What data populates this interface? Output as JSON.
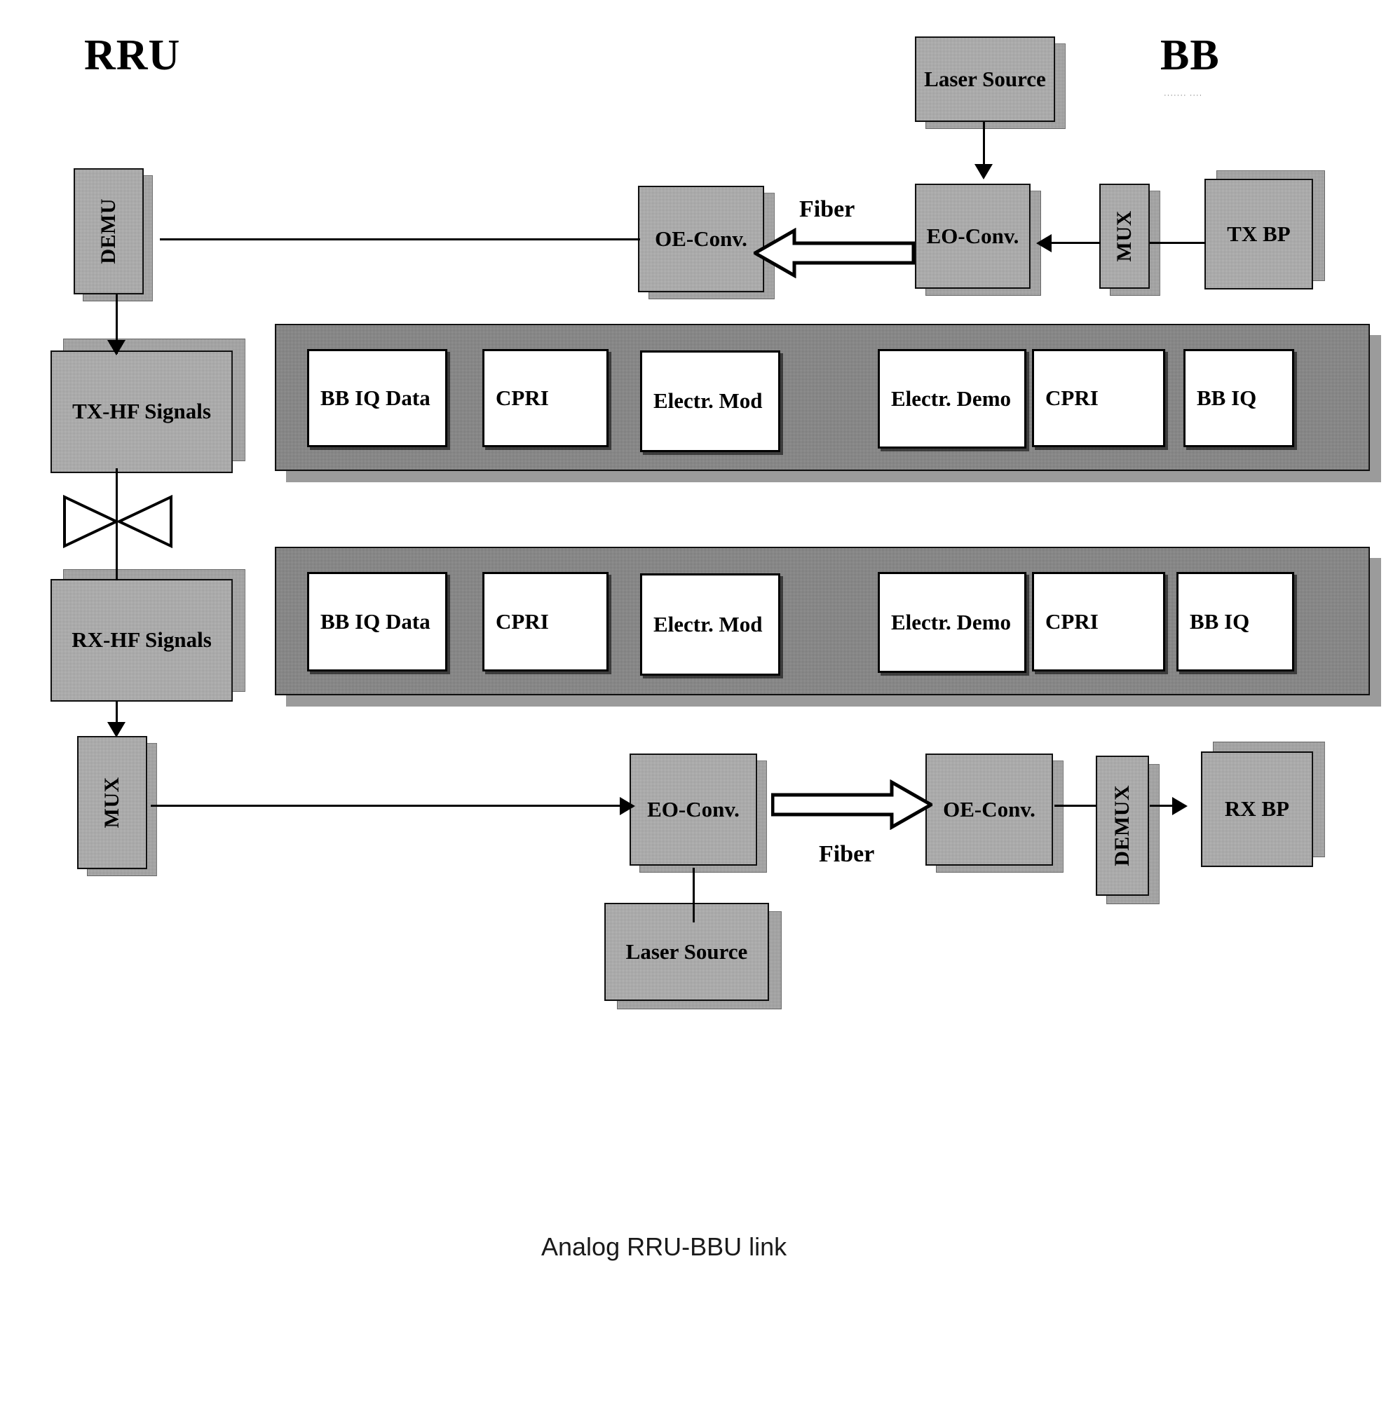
{
  "figure": {
    "caption": "Analog RRU-BBU link",
    "side_labels": {
      "left": "RRU",
      "right": "BB",
      "right_sub": "·······  ····"
    },
    "colors": {
      "box_fill": "#c9c9c9",
      "panel_fill": "#a6a6a6",
      "cell_fill": "#ffffff",
      "stroke": "#000000",
      "caption_text": "#1a1a1a"
    }
  },
  "downlink": {
    "laser_source": "Laser Source",
    "oe_conv": "OE-Conv.",
    "fiber": "Fiber",
    "eo_conv": "EO-Conv.",
    "mux": "MUX",
    "tx_bp": "TX BP",
    "demux": "DEMU"
  },
  "rru": {
    "tx_hf": "TX-HF Signals",
    "rx_hf": "RX-HF Signals",
    "mux": "MUX",
    "antenna_symbol": "antenna"
  },
  "uplink": {
    "eo_conv": "EO-Conv.",
    "fiber": "Fiber",
    "oe_conv": "OE-Conv.",
    "demux": "DEMUX",
    "rx_bp": "RX BP",
    "laser_source": "Laser Source"
  },
  "panels": [
    {
      "id": "downlink-stack",
      "cells": [
        {
          "label": "BB IQ Data"
        },
        {
          "label": "CPRI"
        },
        {
          "label": "Electr. Mod"
        },
        {
          "label": "Electr. Demo"
        },
        {
          "label": "CPRI"
        },
        {
          "label": "BB IQ"
        }
      ]
    },
    {
      "id": "uplink-stack",
      "cells": [
        {
          "label": "BB IQ Data"
        },
        {
          "label": "CPRI"
        },
        {
          "label": "Electr. Mod"
        },
        {
          "label": "Electr. Demo"
        },
        {
          "label": "CPRI"
        },
        {
          "label": "BB IQ"
        }
      ]
    }
  ]
}
